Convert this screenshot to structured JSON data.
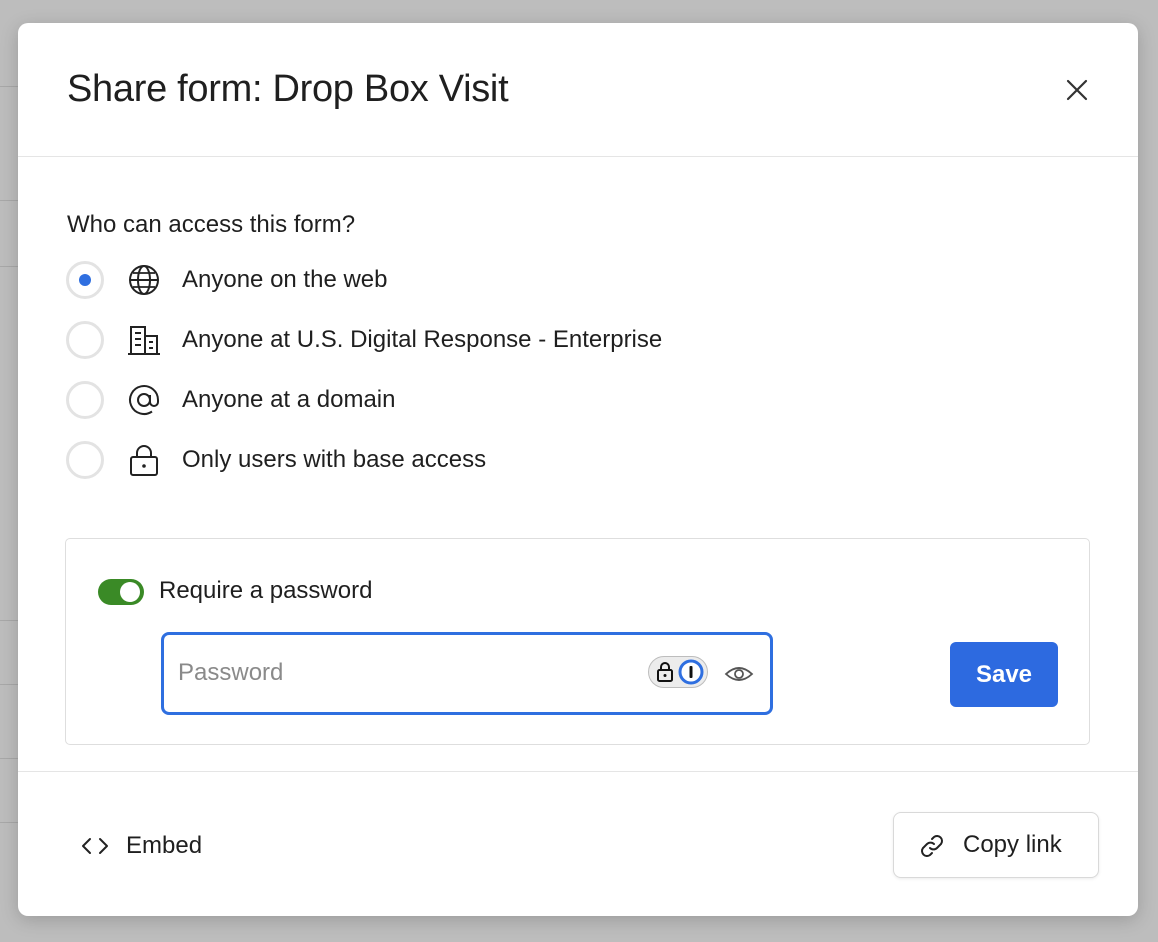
{
  "modal": {
    "title": "Share form: Drop Box Visit"
  },
  "access": {
    "question": "Who can access this form?",
    "options": [
      {
        "label": "Anyone on the web",
        "icon": "globe-icon",
        "selected": true
      },
      {
        "label": "Anyone at U.S. Digital Response - Enterprise",
        "icon": "building-icon",
        "selected": false
      },
      {
        "label": "Anyone at a domain",
        "icon": "at-sign-icon",
        "selected": false
      },
      {
        "label": "Only users with base access",
        "icon": "lock-icon",
        "selected": false
      }
    ]
  },
  "password": {
    "toggle_label": "Require a password",
    "toggle_on": true,
    "placeholder": "Password",
    "value": "",
    "save_label": "Save"
  },
  "footer": {
    "embed_label": "Embed",
    "copy_link_label": "Copy link"
  },
  "colors": {
    "accent": "#2f6fe0",
    "toggle_on": "#3a8a26"
  }
}
